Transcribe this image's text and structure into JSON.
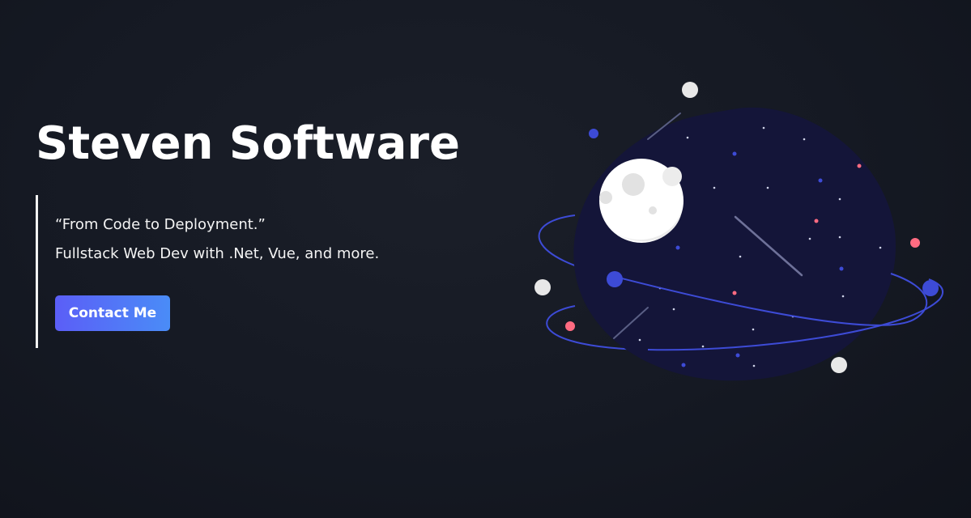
{
  "hero": {
    "title": "Steven Software",
    "quote": "“From Code to Deployment.”",
    "tagline": "Fullstack Web Dev with .Net, Vue, and more.",
    "contact_button_label": "Contact Me"
  },
  "illustration": {
    "icon": "space-planet-illustration",
    "colors": {
      "planet": "#141539",
      "orbit": "#3d4bd6",
      "moon": "#ffffff",
      "star_white": "#e8e8e8",
      "star_pink": "#ff6b81",
      "star_blue": "#3d4bd6"
    }
  },
  "colors": {
    "background": "#151923",
    "accent_gradient_start": "#5b5ef7",
    "accent_gradient_end": "#4a8cf7",
    "border_accent": "#f2f2f2"
  }
}
